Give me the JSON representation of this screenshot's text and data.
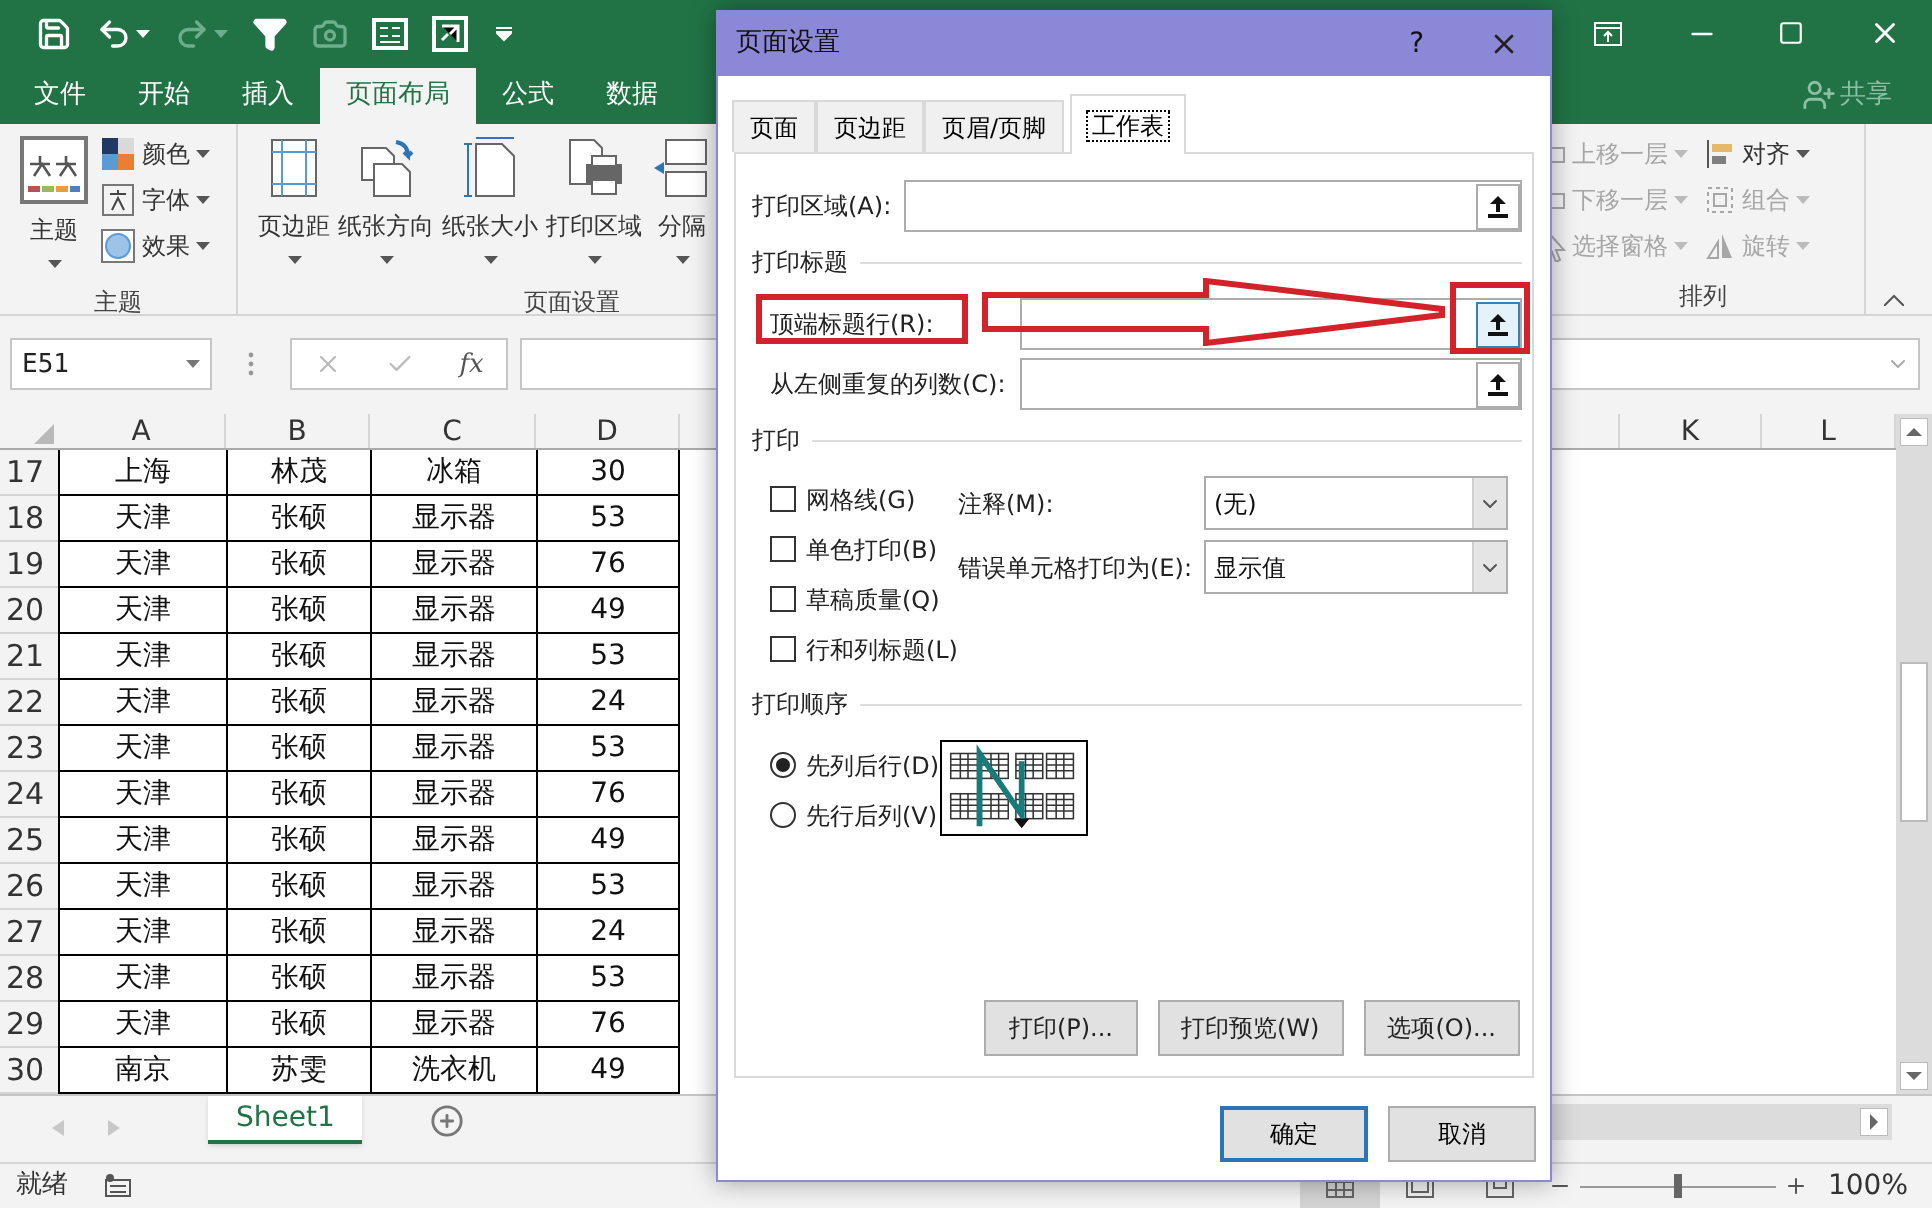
{
  "ribbon_tabs": [
    {
      "label": "文件",
      "selected": false
    },
    {
      "label": "开始",
      "selected": false
    },
    {
      "label": "插入",
      "selected": false
    },
    {
      "label": "页面布局",
      "selected": true
    },
    {
      "label": "公式",
      "selected": false
    },
    {
      "label": "数据",
      "selected": false
    }
  ],
  "share": "共享",
  "ribbon_groups": [
    {
      "label": "主题",
      "items": [
        {
          "kind": "large",
          "label": "主题",
          "disabled": false
        },
        {
          "kind": "small",
          "label": "颜色",
          "disabled": false
        },
        {
          "kind": "small",
          "label": "字体",
          "disabled": false
        },
        {
          "kind": "small",
          "label": "效果",
          "disabled": false
        }
      ]
    },
    {
      "label": "页面设置",
      "items": [
        {
          "kind": "large",
          "label": "页边距",
          "disabled": false
        },
        {
          "kind": "large",
          "label": "纸张方向",
          "disabled": false
        },
        {
          "kind": "large",
          "label": "纸张大小",
          "disabled": false
        },
        {
          "kind": "large",
          "label": "打印区域",
          "disabled": false
        },
        {
          "kind": "large",
          "label": "分隔",
          "disabled": false
        }
      ]
    },
    {
      "label": "排列",
      "items": [
        {
          "kind": "small",
          "label": "上移一层",
          "disabled": true
        },
        {
          "kind": "small",
          "label": "下移一层",
          "disabled": true
        },
        {
          "kind": "small",
          "label": "选择窗格",
          "disabled": true
        },
        {
          "kind": "small",
          "label": "对齐",
          "disabled": false
        },
        {
          "kind": "small",
          "label": "组合",
          "disabled": true
        },
        {
          "kind": "small",
          "label": "旋转",
          "disabled": true
        }
      ]
    }
  ],
  "name_box": "E51",
  "function_label": "fx",
  "columns": [
    "A",
    "B",
    "C",
    "D"
  ],
  "right_columns": [
    "K",
    "L"
  ],
  "rows": [
    {
      "number": "17",
      "cells": [
        "上海",
        "林茂",
        "冰箱",
        "30"
      ]
    },
    {
      "number": "18",
      "cells": [
        "天津",
        "张硕",
        "显示器",
        "53"
      ]
    },
    {
      "number": "19",
      "cells": [
        "天津",
        "张硕",
        "显示器",
        "76"
      ]
    },
    {
      "number": "20",
      "cells": [
        "天津",
        "张硕",
        "显示器",
        "49"
      ]
    },
    {
      "number": "21",
      "cells": [
        "天津",
        "张硕",
        "显示器",
        "53"
      ]
    },
    {
      "number": "22",
      "cells": [
        "天津",
        "张硕",
        "显示器",
        "24"
      ]
    },
    {
      "number": "23",
      "cells": [
        "天津",
        "张硕",
        "显示器",
        "53"
      ]
    },
    {
      "number": "24",
      "cells": [
        "天津",
        "张硕",
        "显示器",
        "76"
      ]
    },
    {
      "number": "25",
      "cells": [
        "天津",
        "张硕",
        "显示器",
        "49"
      ]
    },
    {
      "number": "26",
      "cells": [
        "天津",
        "张硕",
        "显示器",
        "53"
      ]
    },
    {
      "number": "27",
      "cells": [
        "天津",
        "张硕",
        "显示器",
        "24"
      ]
    },
    {
      "number": "28",
      "cells": [
        "天津",
        "张硕",
        "显示器",
        "53"
      ]
    },
    {
      "number": "29",
      "cells": [
        "天津",
        "张硕",
        "显示器",
        "76"
      ]
    },
    {
      "number": "30",
      "cells": [
        "南京",
        "苏雯",
        "洗衣机",
        "49"
      ]
    }
  ],
  "sheet_tabs": [
    {
      "label": "Sheet1",
      "selected": true
    }
  ],
  "status": "就绪",
  "zoom": {
    "level": 0.5,
    "reading": "100%"
  },
  "dialog": {
    "title": "页面设置",
    "help": "?",
    "tabs": [
      {
        "label": "页面",
        "selected": false
      },
      {
        "label": "页边距",
        "selected": false
      },
      {
        "label": "页眉/页脚",
        "selected": false
      },
      {
        "label": "工作表",
        "selected": true
      }
    ],
    "print_area": {
      "label": "打印区域(A):"
    },
    "print_titles": {
      "heading": "打印标题",
      "fields": [
        {
          "label": "顶端标题行(R):",
          "highlighted": true
        },
        {
          "label": "从左侧重复的列数(C):",
          "highlighted": false
        }
      ]
    },
    "print": {
      "heading": "打印",
      "options": [
        {
          "label": "网格线(G)",
          "checked": false
        },
        {
          "label": "单色打印(B)",
          "checked": false
        },
        {
          "label": "草稿质量(Q)",
          "checked": false
        },
        {
          "label": "行和列标题(L)",
          "checked": false
        }
      ],
      "comments": {
        "label": "注释(M):",
        "value": "(无)"
      },
      "errors": {
        "label": "错误单元格打印为(E):",
        "value": "显示值"
      }
    },
    "page_order": {
      "heading": "打印顺序",
      "options": [
        {
          "label": "先列后行(D)",
          "selected": true
        },
        {
          "label": "先行后列(V)",
          "selected": false
        }
      ]
    },
    "buttons": [
      "打印(P)...",
      "打印预览(W)",
      "选项(O)..."
    ],
    "footer_buttons": [
      {
        "label": "确定",
        "default": true
      },
      {
        "label": "取消",
        "default": false
      }
    ]
  }
}
